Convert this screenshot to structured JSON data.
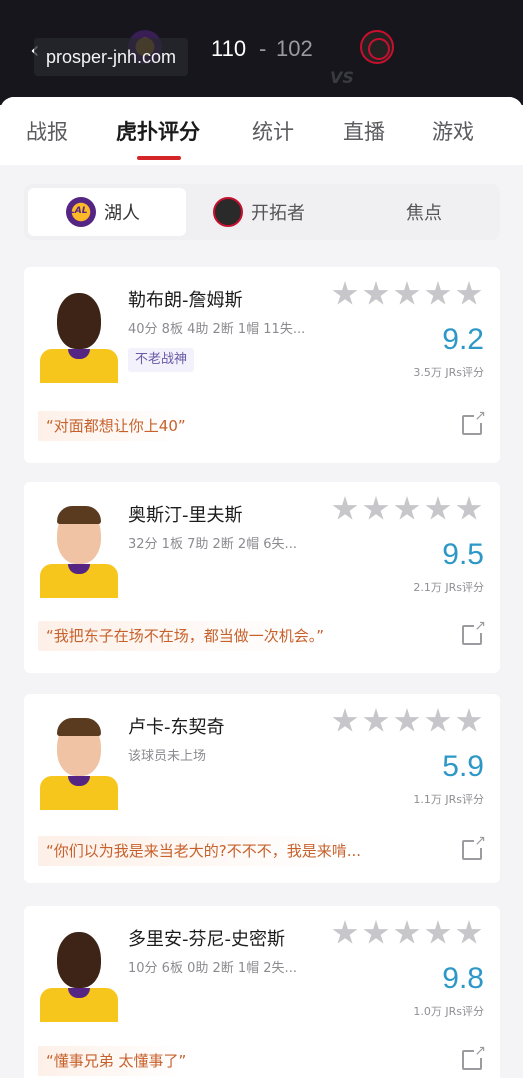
{
  "scoreboard": {
    "watermark": "prosper-jnh.com",
    "home_score": "110",
    "separator": "-",
    "away_score": "102",
    "vs_text": "VS",
    "back_icon": "chevron-left-icon",
    "home_logo": "lakers-logo-icon",
    "away_logo": "blazers-logo-icon"
  },
  "tabs": [
    {
      "label": "战报"
    },
    {
      "label": "虎扑评分"
    },
    {
      "label": "统计"
    },
    {
      "label": "直播"
    },
    {
      "label": "游戏"
    }
  ],
  "active_tab": 1,
  "team_switch": {
    "lakers": "湖人",
    "blazers": "开拓者",
    "focus": "焦点"
  },
  "colors": {
    "accent_red": "#d42528",
    "rating_blue": "#2d98c8",
    "comment_orange": "#c7612c",
    "lakers_gold": "#f6c61c",
    "lakers_purple": "#552583"
  },
  "players": [
    {
      "name": "勒布朗-詹姆斯",
      "stats": "40分 8板 4助 2断 1帽 11失...",
      "badge": "不老战神",
      "rating": "9.2",
      "rating_count": "3.5万 JRs评分",
      "comment": "“对面都想让你上40”"
    },
    {
      "name": "奥斯汀-里夫斯",
      "stats": "32分 1板 7助 2断 2帽 6失...",
      "rating": "9.5",
      "rating_count": "2.1万 JRs评分",
      "comment": "“我把东子在场不在场，都当做一次机会。”"
    },
    {
      "name": "卢卡-东契奇",
      "stats": "该球员未上场",
      "rating": "5.9",
      "rating_count": "1.1万 JRs评分",
      "comment": "“你们以为我是来当老大的?不不不，我是来啃..."
    },
    {
      "name": "多里安-芬尼-史密斯",
      "stats": "10分 6板 0助 2断 1帽 2失...",
      "rating": "9.8",
      "rating_count": "1.0万 JRs评分",
      "comment": "“懂事兄弟 太懂事了”"
    }
  ]
}
